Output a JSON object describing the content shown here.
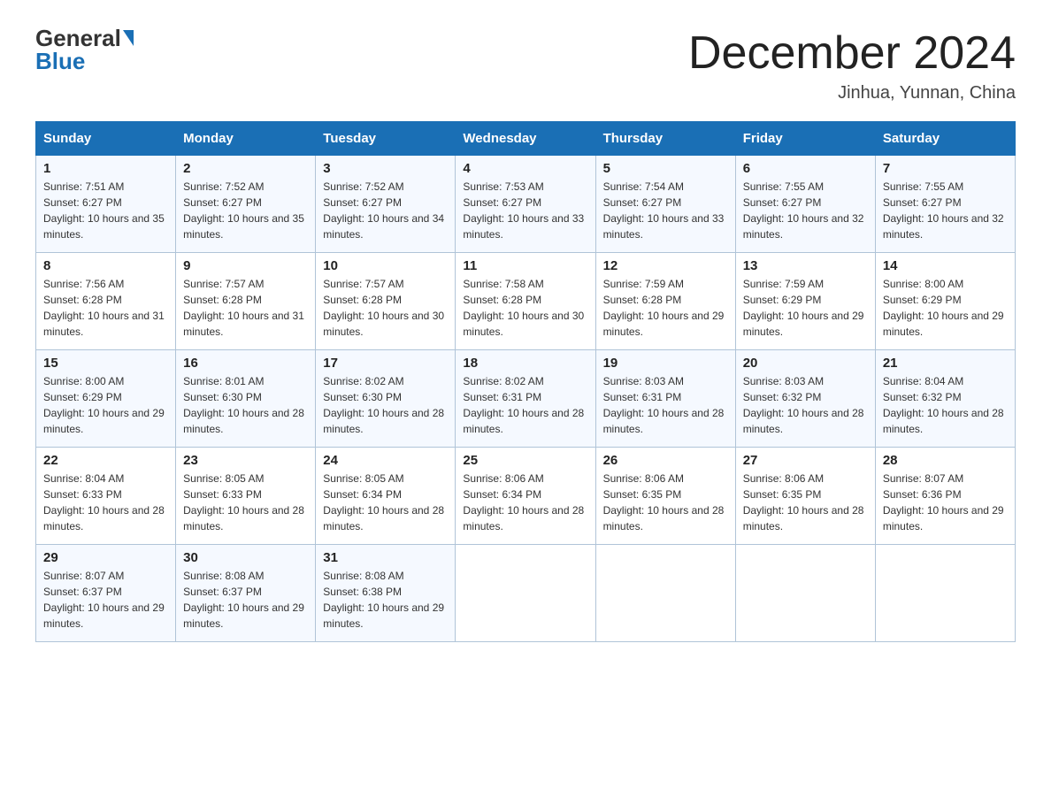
{
  "logo": {
    "text1": "General",
    "text2": "Blue"
  },
  "title": "December 2024",
  "location": "Jinhua, Yunnan, China",
  "weekdays": [
    "Sunday",
    "Monday",
    "Tuesday",
    "Wednesday",
    "Thursday",
    "Friday",
    "Saturday"
  ],
  "weeks": [
    [
      {
        "day": "1",
        "sunrise": "Sunrise: 7:51 AM",
        "sunset": "Sunset: 6:27 PM",
        "daylight": "Daylight: 10 hours and 35 minutes."
      },
      {
        "day": "2",
        "sunrise": "Sunrise: 7:52 AM",
        "sunset": "Sunset: 6:27 PM",
        "daylight": "Daylight: 10 hours and 35 minutes."
      },
      {
        "day": "3",
        "sunrise": "Sunrise: 7:52 AM",
        "sunset": "Sunset: 6:27 PM",
        "daylight": "Daylight: 10 hours and 34 minutes."
      },
      {
        "day": "4",
        "sunrise": "Sunrise: 7:53 AM",
        "sunset": "Sunset: 6:27 PM",
        "daylight": "Daylight: 10 hours and 33 minutes."
      },
      {
        "day": "5",
        "sunrise": "Sunrise: 7:54 AM",
        "sunset": "Sunset: 6:27 PM",
        "daylight": "Daylight: 10 hours and 33 minutes."
      },
      {
        "day": "6",
        "sunrise": "Sunrise: 7:55 AM",
        "sunset": "Sunset: 6:27 PM",
        "daylight": "Daylight: 10 hours and 32 minutes."
      },
      {
        "day": "7",
        "sunrise": "Sunrise: 7:55 AM",
        "sunset": "Sunset: 6:27 PM",
        "daylight": "Daylight: 10 hours and 32 minutes."
      }
    ],
    [
      {
        "day": "8",
        "sunrise": "Sunrise: 7:56 AM",
        "sunset": "Sunset: 6:28 PM",
        "daylight": "Daylight: 10 hours and 31 minutes."
      },
      {
        "day": "9",
        "sunrise": "Sunrise: 7:57 AM",
        "sunset": "Sunset: 6:28 PM",
        "daylight": "Daylight: 10 hours and 31 minutes."
      },
      {
        "day": "10",
        "sunrise": "Sunrise: 7:57 AM",
        "sunset": "Sunset: 6:28 PM",
        "daylight": "Daylight: 10 hours and 30 minutes."
      },
      {
        "day": "11",
        "sunrise": "Sunrise: 7:58 AM",
        "sunset": "Sunset: 6:28 PM",
        "daylight": "Daylight: 10 hours and 30 minutes."
      },
      {
        "day": "12",
        "sunrise": "Sunrise: 7:59 AM",
        "sunset": "Sunset: 6:28 PM",
        "daylight": "Daylight: 10 hours and 29 minutes."
      },
      {
        "day": "13",
        "sunrise": "Sunrise: 7:59 AM",
        "sunset": "Sunset: 6:29 PM",
        "daylight": "Daylight: 10 hours and 29 minutes."
      },
      {
        "day": "14",
        "sunrise": "Sunrise: 8:00 AM",
        "sunset": "Sunset: 6:29 PM",
        "daylight": "Daylight: 10 hours and 29 minutes."
      }
    ],
    [
      {
        "day": "15",
        "sunrise": "Sunrise: 8:00 AM",
        "sunset": "Sunset: 6:29 PM",
        "daylight": "Daylight: 10 hours and 29 minutes."
      },
      {
        "day": "16",
        "sunrise": "Sunrise: 8:01 AM",
        "sunset": "Sunset: 6:30 PM",
        "daylight": "Daylight: 10 hours and 28 minutes."
      },
      {
        "day": "17",
        "sunrise": "Sunrise: 8:02 AM",
        "sunset": "Sunset: 6:30 PM",
        "daylight": "Daylight: 10 hours and 28 minutes."
      },
      {
        "day": "18",
        "sunrise": "Sunrise: 8:02 AM",
        "sunset": "Sunset: 6:31 PM",
        "daylight": "Daylight: 10 hours and 28 minutes."
      },
      {
        "day": "19",
        "sunrise": "Sunrise: 8:03 AM",
        "sunset": "Sunset: 6:31 PM",
        "daylight": "Daylight: 10 hours and 28 minutes."
      },
      {
        "day": "20",
        "sunrise": "Sunrise: 8:03 AM",
        "sunset": "Sunset: 6:32 PM",
        "daylight": "Daylight: 10 hours and 28 minutes."
      },
      {
        "day": "21",
        "sunrise": "Sunrise: 8:04 AM",
        "sunset": "Sunset: 6:32 PM",
        "daylight": "Daylight: 10 hours and 28 minutes."
      }
    ],
    [
      {
        "day": "22",
        "sunrise": "Sunrise: 8:04 AM",
        "sunset": "Sunset: 6:33 PM",
        "daylight": "Daylight: 10 hours and 28 minutes."
      },
      {
        "day": "23",
        "sunrise": "Sunrise: 8:05 AM",
        "sunset": "Sunset: 6:33 PM",
        "daylight": "Daylight: 10 hours and 28 minutes."
      },
      {
        "day": "24",
        "sunrise": "Sunrise: 8:05 AM",
        "sunset": "Sunset: 6:34 PM",
        "daylight": "Daylight: 10 hours and 28 minutes."
      },
      {
        "day": "25",
        "sunrise": "Sunrise: 8:06 AM",
        "sunset": "Sunset: 6:34 PM",
        "daylight": "Daylight: 10 hours and 28 minutes."
      },
      {
        "day": "26",
        "sunrise": "Sunrise: 8:06 AM",
        "sunset": "Sunset: 6:35 PM",
        "daylight": "Daylight: 10 hours and 28 minutes."
      },
      {
        "day": "27",
        "sunrise": "Sunrise: 8:06 AM",
        "sunset": "Sunset: 6:35 PM",
        "daylight": "Daylight: 10 hours and 28 minutes."
      },
      {
        "day": "28",
        "sunrise": "Sunrise: 8:07 AM",
        "sunset": "Sunset: 6:36 PM",
        "daylight": "Daylight: 10 hours and 29 minutes."
      }
    ],
    [
      {
        "day": "29",
        "sunrise": "Sunrise: 8:07 AM",
        "sunset": "Sunset: 6:37 PM",
        "daylight": "Daylight: 10 hours and 29 minutes."
      },
      {
        "day": "30",
        "sunrise": "Sunrise: 8:08 AM",
        "sunset": "Sunset: 6:37 PM",
        "daylight": "Daylight: 10 hours and 29 minutes."
      },
      {
        "day": "31",
        "sunrise": "Sunrise: 8:08 AM",
        "sunset": "Sunset: 6:38 PM",
        "daylight": "Daylight: 10 hours and 29 minutes."
      },
      null,
      null,
      null,
      null
    ]
  ]
}
